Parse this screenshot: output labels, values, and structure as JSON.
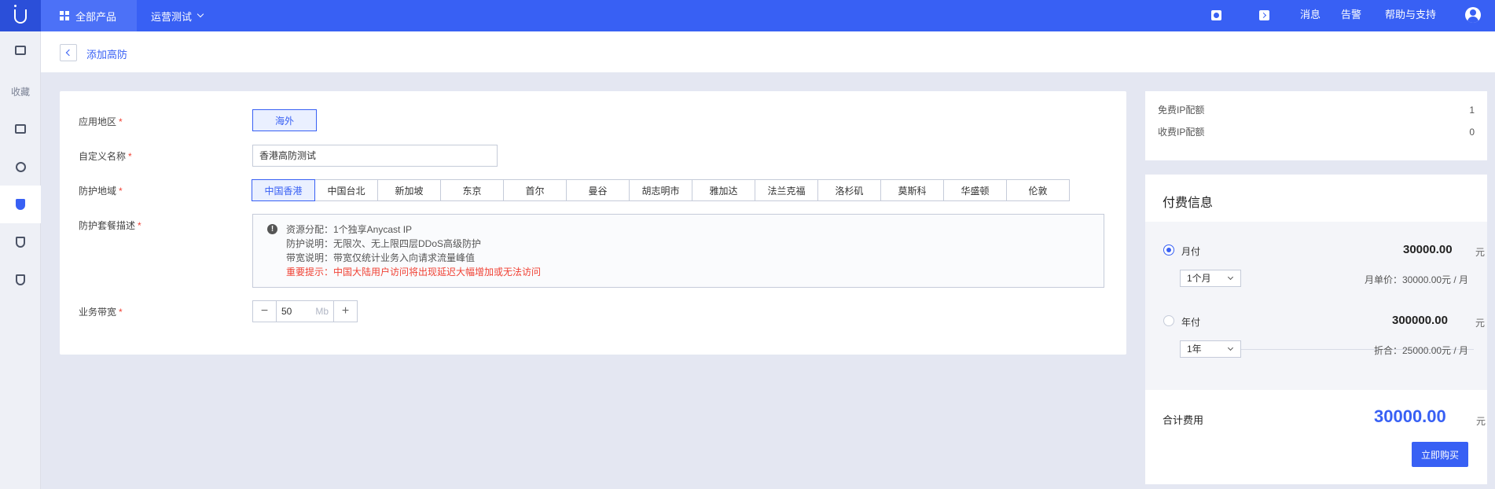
{
  "topbar": {
    "all_products": "全部产品",
    "project": "运营测试",
    "messages": "消息",
    "alerts": "告警",
    "help": "帮助与支持",
    "accent_color": "#3860f4"
  },
  "sidebar": {
    "favorites": "收藏"
  },
  "page": {
    "title": "添加高防"
  },
  "form": {
    "region_label": "应用地区",
    "region_value": "海外",
    "name_label": "自定义名称",
    "name_value": "香港高防测试",
    "area_label": "防护地域",
    "areas": [
      "中国香港",
      "中国台北",
      "新加坡",
      "东京",
      "首尔",
      "曼谷",
      "胡志明市",
      "雅加达",
      "法兰克福",
      "洛杉矶",
      "莫斯科",
      "华盛顿",
      "伦敦"
    ],
    "selected_area": "中国香港",
    "desc_label": "防护套餐描述",
    "desc_lines": [
      "资源分配：1个独享Anycast IP",
      "防护说明：无限次、无上限四层DDoS高级防护",
      "带宽说明：带宽仅统计业务入向请求流量峰值"
    ],
    "desc_warning": "重要提示：中国大陆用户访问将出现延迟大幅增加或无法访问",
    "bandwidth_label": "业务带宽",
    "bandwidth_value": "50",
    "bandwidth_unit": "Mb",
    "minus": "−",
    "plus": "+"
  },
  "quota": {
    "free_label": "免费IP配额",
    "free_value": "1",
    "paid_label": "收费IP配额",
    "paid_value": "0"
  },
  "payment": {
    "title": "付费信息",
    "monthly_label": "月付",
    "monthly_price": "30000.00",
    "monthly_select": "1个月",
    "monthly_unit_price": "月单价：30000.00元 / 月",
    "yearly_label": "年付",
    "yearly_price": "300000.00",
    "yearly_select": "1年",
    "yearly_unit_price": "折合：25000.00元 / 月",
    "yuan": "元",
    "total_label": "合计费用",
    "total_price": "30000.00",
    "buy_button": "立即购买"
  }
}
